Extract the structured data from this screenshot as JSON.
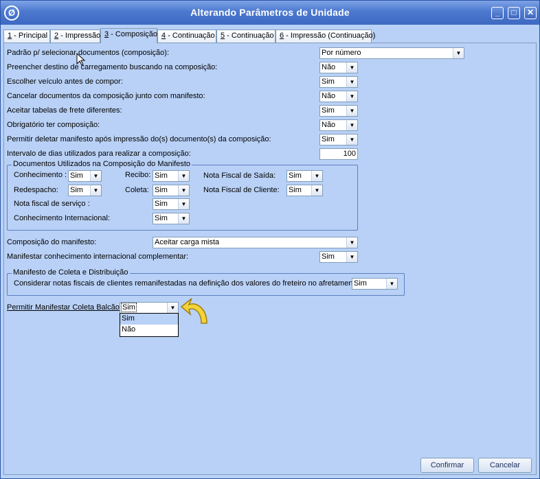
{
  "window": {
    "title": "Alterando Parâmetros de Unidade",
    "icon": "app-logo-icon",
    "controls": {
      "minimize": "_",
      "maximize": "□",
      "close": "✕"
    }
  },
  "tabs": [
    {
      "num": "1",
      "label": " - Principal"
    },
    {
      "num": "2",
      "label": " - Impressão"
    },
    {
      "num": "3",
      "label": " - Composição"
    },
    {
      "num": "4",
      "label": " - Continuação"
    },
    {
      "num": "5",
      "label": " - Continuação"
    },
    {
      "num": "6",
      "label": " - Impressão (Continuação)"
    }
  ],
  "settings": [
    {
      "label": "Padrão p/ selecionar documentos (composição):",
      "value": "Por número"
    },
    {
      "label": "Preencher destino de carregamento buscando na composição:",
      "value": "Não"
    },
    {
      "label": "Escolher veículo antes de compor:",
      "value": "Sim"
    },
    {
      "label": "Cancelar documentos da composição junto com manifesto:",
      "value": "Não"
    },
    {
      "label": "Aceitar tabelas de frete diferentes:",
      "value": "Sim"
    },
    {
      "label": "Obrigatório ter composição:",
      "value": "Não"
    },
    {
      "label": "Permitir deletar manifesto após impressão do(s) documento(s) da composição:",
      "value": "Sim"
    },
    {
      "label": "Intervalo de dias utilizados para realizar a composição:",
      "value": "100"
    }
  ],
  "docs_group": {
    "title": "Documentos Utilizados na Composição do Manifesto",
    "conhecimento": {
      "label": "Conhecimento :",
      "value": "Sim"
    },
    "recibo": {
      "label": "Recibo:",
      "value": "Sim"
    },
    "nf_saida": {
      "label": "Nota Fiscal de Saída:",
      "value": "Sim"
    },
    "redespacho": {
      "label": "Redespacho:",
      "value": "Sim"
    },
    "coleta": {
      "label": "Coleta:",
      "value": "Sim"
    },
    "nf_cliente": {
      "label": "Nota Fiscal de Cliente:",
      "value": "Sim"
    },
    "nf_servico": {
      "label": "Nota fiscal de serviço :",
      "value": "Sim"
    },
    "conh_internacional": {
      "label": "Conhecimento Internacional:",
      "value": "Sim"
    }
  },
  "composicao": {
    "label": "Composição do manifesto:",
    "value": "Aceitar carga mista"
  },
  "manifestar_complementar": {
    "label": "Manifestar conhecimento internacional complementar:",
    "value": "Sim"
  },
  "coleta_group": {
    "title": "Manifesto de Coleta e Distribuição",
    "label": "Considerar notas fiscais de clientes remanifestadas na definição dos valores do freteiro no afretamento:",
    "value": "Sim"
  },
  "balcao": {
    "label": "Permitir Manifestar Coleta Balcão :",
    "value": "Sim",
    "options": [
      "Sim",
      "Não"
    ]
  },
  "buttons": {
    "confirm": "Confirmar",
    "cancel": "Cancelar"
  }
}
